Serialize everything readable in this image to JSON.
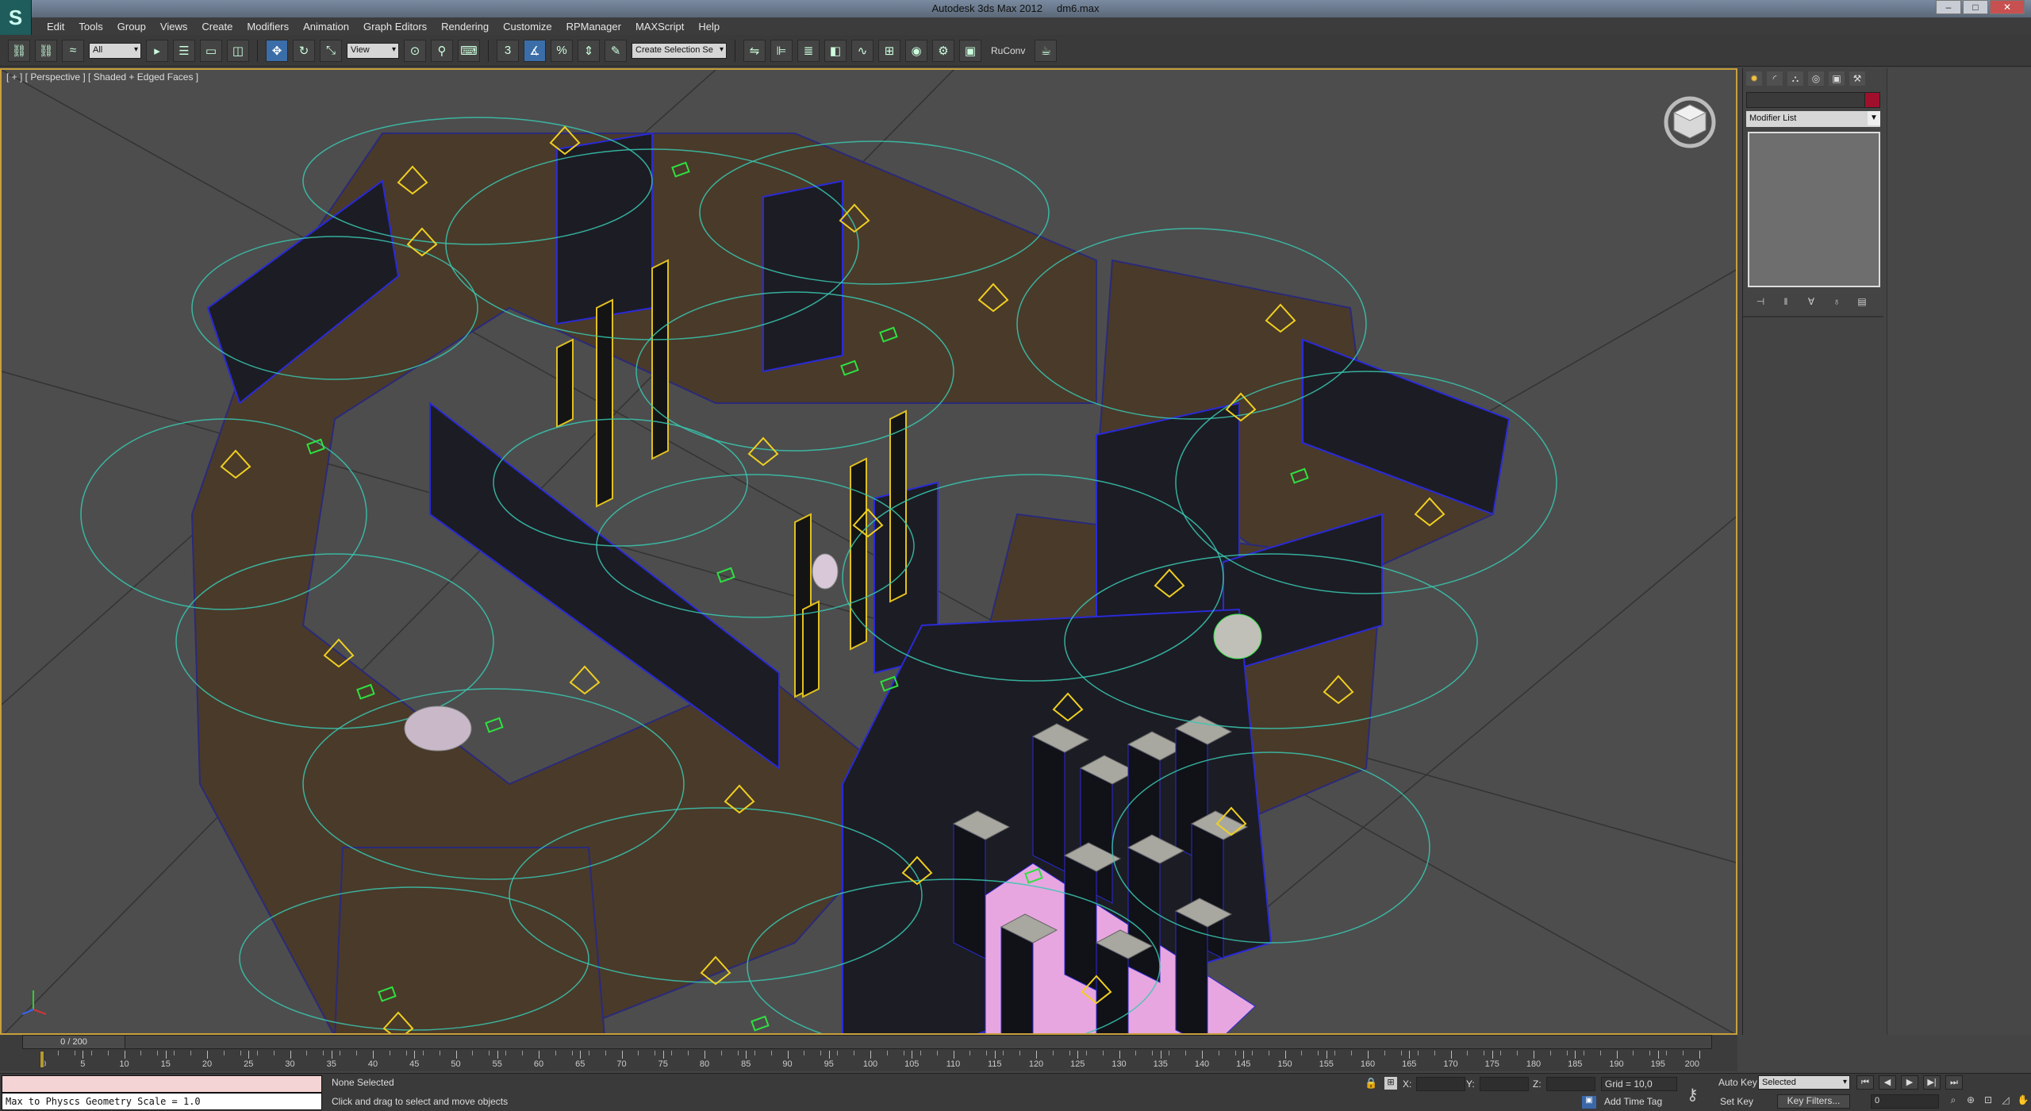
{
  "app": {
    "title": "Autodesk 3ds Max  2012",
    "file": "dm6.max",
    "logo_glyph": "S"
  },
  "window_buttons": {
    "minimize": "–",
    "maximize": "□",
    "close": "✕"
  },
  "menu": [
    "Edit",
    "Tools",
    "Group",
    "Views",
    "Create",
    "Modifiers",
    "Animation",
    "Graph Editors",
    "Rendering",
    "Customize",
    "RPManager",
    "MAXScript",
    "Help"
  ],
  "toolbar": {
    "selection_filter": "All",
    "reference_coord": "View",
    "named_selection": "Create Selection Se",
    "plugin_label": "RuConv",
    "icons": [
      "link-icon",
      "unlink-icon",
      "bind-space-warp-icon",
      "select-object-icon",
      "select-by-name-icon",
      "rect-region-icon",
      "window-crossing-icon",
      "move-icon",
      "rotate-icon",
      "scale-icon",
      "pivot-icon",
      "manipulate-icon",
      "keyboard-shortcut-icon",
      "snap-3-icon",
      "angle-snap-icon",
      "percent-snap-icon",
      "spinner-snap-icon",
      "edit-named-sets-icon",
      "mirror-icon",
      "align-icon",
      "layer-manager-icon",
      "graphite-icon",
      "curve-editor-icon",
      "schematic-icon",
      "material-editor-icon",
      "render-setup-icon",
      "rendered-frame-icon",
      "render-icon"
    ]
  },
  "viewport": {
    "label": "[ + ] [ Perspective ] [ Shaded + Edged Faces ]",
    "background": "#4d4d4d",
    "active_border": "#c8a03c"
  },
  "command_panel": {
    "tabs": [
      "create-tab",
      "modify-tab",
      "hierarchy-tab",
      "motion-tab",
      "display-tab",
      "utilities-tab"
    ],
    "active_tab": "create-tab",
    "object_color": "#a0102c",
    "modifier_list": "Modifier List",
    "stack_buttons": [
      "pin-stack-icon",
      "show-end-result-icon",
      "make-unique-icon",
      "remove-modifier-icon",
      "configure-modifier-sets-icon"
    ]
  },
  "timeline": {
    "slider_text": "0 / 200",
    "frame_min": 0,
    "frame_max": 200,
    "tick_labels": [
      "0",
      "5",
      "10",
      "15",
      "20",
      "25",
      "30",
      "35",
      "40",
      "45",
      "50",
      "55",
      "60",
      "65",
      "70",
      "75",
      "80",
      "85",
      "90",
      "95",
      "100",
      "105",
      "110",
      "115",
      "120",
      "125",
      "130",
      "135",
      "140",
      "145",
      "150",
      "155",
      "160",
      "165",
      "170",
      "175",
      "180",
      "185",
      "190",
      "195",
      "200"
    ]
  },
  "status": {
    "maxscript_output": "Max to Physcs Geometry Scale = 1.0",
    "selection": "None Selected",
    "prompt": "Click and drag to select and move objects",
    "x_label": "X:",
    "y_label": "Y:",
    "z_label": "Z:",
    "grid": "Grid = 10,0",
    "add_time_tag": "Add Time Tag",
    "auto_key": "Auto Key",
    "set_key": "Set Key",
    "key_mode": "Selected",
    "key_filters": "Key Filters...",
    "current_frame": "0"
  }
}
